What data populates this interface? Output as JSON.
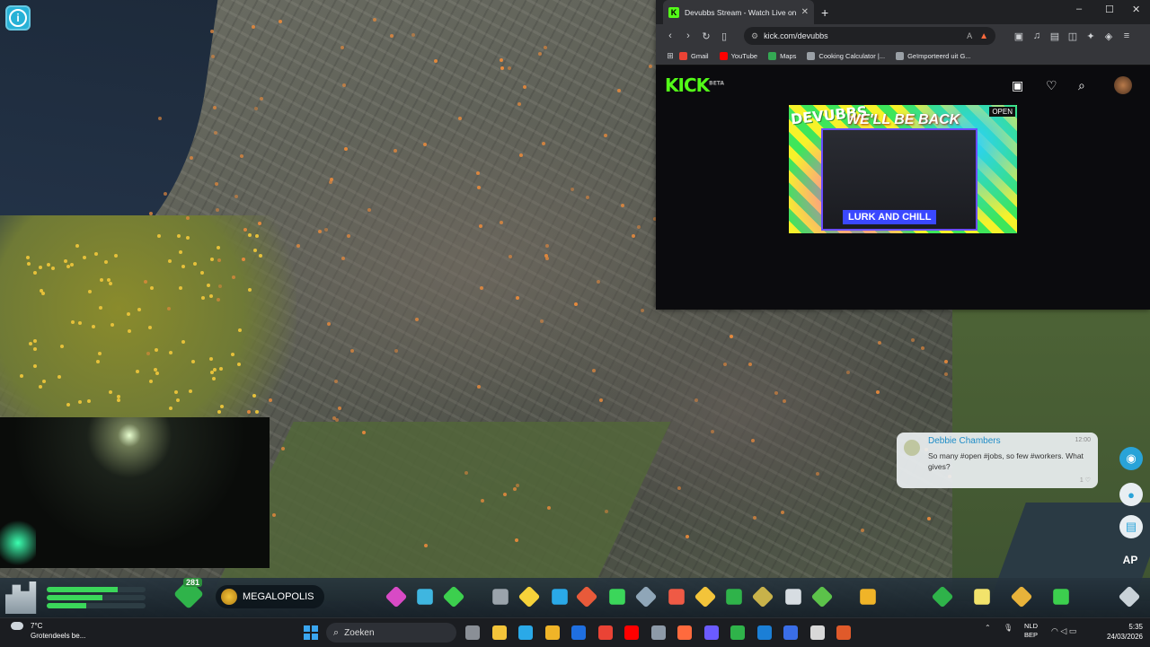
{
  "browser": {
    "tab_title": "Devubbs Stream - Watch Live on Kick",
    "url": "kick.com/devubbs",
    "bookmarks": [
      {
        "label": "Gmail",
        "color": "#ea4335"
      },
      {
        "label": "YouTube",
        "color": "#ff0000"
      },
      {
        "label": "Maps",
        "color": "#34a853"
      },
      {
        "label": "Cooking Calculator |...",
        "color": "#9aa0a6"
      },
      {
        "label": "Geïmporteerd uit G...",
        "color": "#9aa0a6"
      }
    ]
  },
  "kick": {
    "logo": "KICK",
    "logo_sup": "BETA",
    "stream": {
      "channel_badge": "DEVUBBS",
      "headline": "WE'LL BE BACK",
      "open_badge": "OPEN",
      "footer": "LURK AND CHILL"
    }
  },
  "chirp": {
    "author": "Debbie Chambers",
    "time": "12:00",
    "message": "So many #open #jobs, so few #workers. What gives?",
    "likes": "1"
  },
  "game": {
    "points": "281",
    "milestone": "MEGALOPOLIS",
    "ap_button": "AP",
    "colors": {
      "accent": "#27b1d6",
      "bar_green": "#3bd65a"
    }
  },
  "taskbar": {
    "weather_temp": "7°C",
    "weather_condition": "Grotendeels be...",
    "search_placeholder": "Zoeken",
    "lang_top": "NLD",
    "lang_bottom": "BEP",
    "time": "5:35",
    "date": "24/03/2026"
  }
}
